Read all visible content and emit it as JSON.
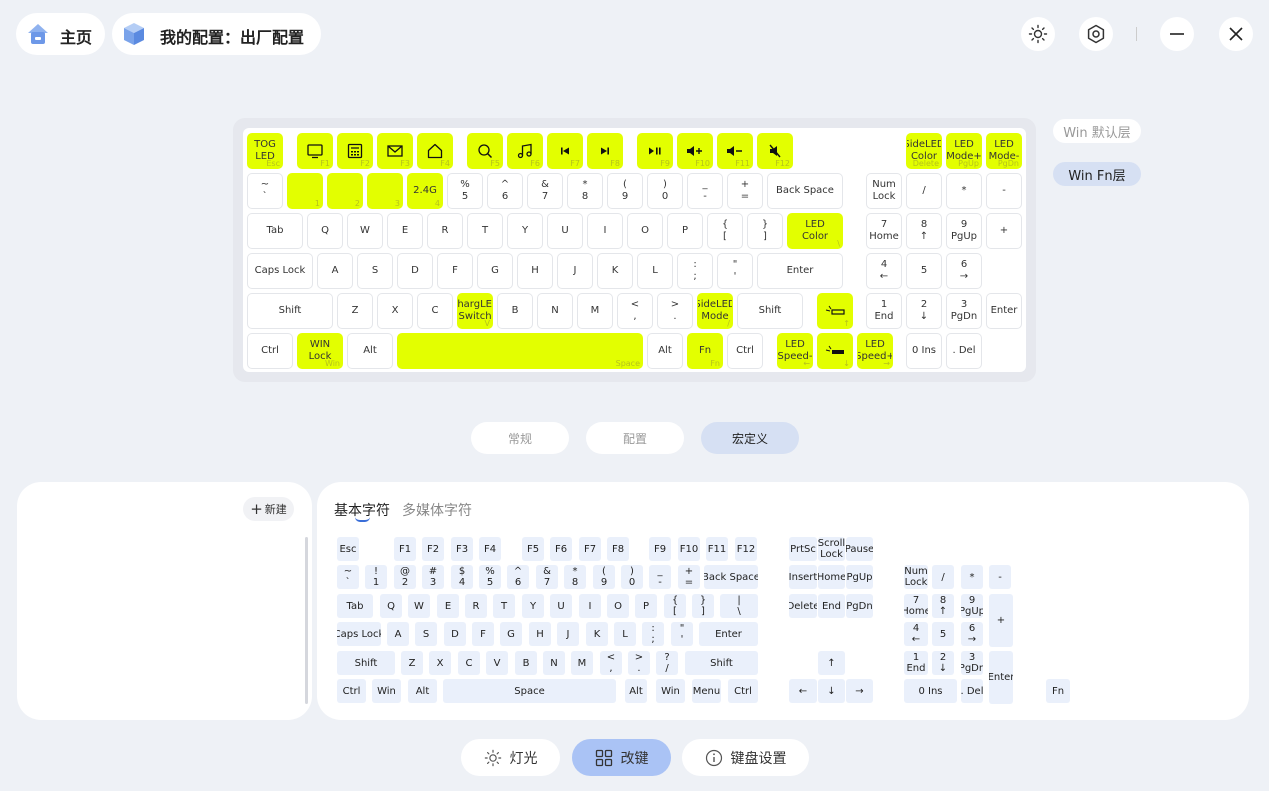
{
  "header": {
    "home_label": "主页",
    "config_label": "我的配置：出厂配置",
    "icons": [
      "house-icon",
      "cube-icon",
      "sun-icon",
      "settings-icon",
      "minimize-icon",
      "close-icon"
    ]
  },
  "keyboard": {
    "rows": [
      [
        {
          "l": [
            "TOG",
            "LED"
          ],
          "s": "Esc",
          "hl": true
        },
        {
          "i": "monitor-icon",
          "s": "F1",
          "hl": true
        },
        {
          "i": "calculator-icon",
          "s": "F2",
          "hl": true
        },
        {
          "i": "mail-icon",
          "s": "F3",
          "hl": true
        },
        {
          "i": "home-icon",
          "s": "F4",
          "hl": true
        },
        {
          "i": "search-icon",
          "s": "F5",
          "hl": true
        },
        {
          "i": "music-icon",
          "s": "F6",
          "hl": true
        },
        {
          "i": "prev-track-icon",
          "s": "F7",
          "hl": true
        },
        {
          "i": "next-track-icon",
          "s": "F8",
          "hl": true
        },
        {
          "i": "play-pause-icon",
          "s": "F9",
          "hl": true
        },
        {
          "i": "volume-up-icon",
          "s": "F10",
          "hl": true
        },
        {
          "i": "volume-down-icon",
          "s": "F11",
          "hl": true
        },
        {
          "i": "mute-icon",
          "s": "F12",
          "hl": true
        },
        {
          "l": [
            "SideLED",
            "Color"
          ],
          "s": "Delete",
          "hl": true
        },
        {
          "l": [
            "LED",
            "Mode+"
          ],
          "s": "PgUp",
          "hl": true
        },
        {
          "l": [
            "LED",
            "Mode-"
          ],
          "s": "PgDn",
          "hl": true
        }
      ],
      [
        {
          "l": [
            "~",
            "`"
          ]
        },
        {
          "l": [
            ""
          ],
          "s": "1",
          "hl": true
        },
        {
          "l": [
            ""
          ],
          "s": "2",
          "hl": true
        },
        {
          "l": [
            ""
          ],
          "s": "3",
          "hl": true
        },
        {
          "l": [
            "2.4G"
          ],
          "s": "4",
          "hl": true
        },
        {
          "l": [
            "%",
            "5"
          ]
        },
        {
          "l": [
            "^",
            "6"
          ]
        },
        {
          "l": [
            "&",
            "7"
          ]
        },
        {
          "l": [
            "*",
            "8"
          ]
        },
        {
          "l": [
            "(",
            "9"
          ]
        },
        {
          "l": [
            ")",
            "0"
          ]
        },
        {
          "l": [
            "_",
            "-"
          ]
        },
        {
          "l": [
            "+",
            "="
          ]
        },
        {
          "l": [
            "Back Space"
          ]
        },
        {
          "l": [
            "Num",
            "Lock"
          ]
        },
        {
          "l": [
            "/"
          ]
        },
        {
          "l": [
            "*"
          ]
        },
        {
          "l": [
            "-"
          ]
        }
      ],
      [
        {
          "l": [
            "Tab"
          ]
        },
        {
          "l": [
            "Q"
          ]
        },
        {
          "l": [
            "W"
          ]
        },
        {
          "l": [
            "E"
          ]
        },
        {
          "l": [
            "R"
          ]
        },
        {
          "l": [
            "T"
          ]
        },
        {
          "l": [
            "Y"
          ]
        },
        {
          "l": [
            "U"
          ]
        },
        {
          "l": [
            "I"
          ]
        },
        {
          "l": [
            "O"
          ]
        },
        {
          "l": [
            "P"
          ]
        },
        {
          "l": [
            "{",
            "["
          ]
        },
        {
          "l": [
            "}",
            "]"
          ]
        },
        {
          "l": [
            "LED",
            "Color"
          ],
          "s": "\\",
          "hl": true
        },
        {
          "l": [
            "7",
            "Home"
          ]
        },
        {
          "l": [
            "8",
            "↑"
          ]
        },
        {
          "l": [
            "9",
            "PgUp"
          ]
        },
        {
          "l": [
            "+"
          ]
        }
      ],
      [
        {
          "l": [
            "Caps Lock"
          ]
        },
        {
          "l": [
            "A"
          ]
        },
        {
          "l": [
            "S"
          ]
        },
        {
          "l": [
            "D"
          ]
        },
        {
          "l": [
            "F"
          ]
        },
        {
          "l": [
            "G"
          ]
        },
        {
          "l": [
            "H"
          ]
        },
        {
          "l": [
            "J"
          ]
        },
        {
          "l": [
            "K"
          ]
        },
        {
          "l": [
            "L"
          ]
        },
        {
          "l": [
            ":",
            ";"
          ]
        },
        {
          "l": [
            "\"",
            "'"
          ]
        },
        {
          "l": [
            "Enter"
          ]
        },
        {
          "l": [
            "4",
            "←"
          ]
        },
        {
          "l": [
            "5"
          ]
        },
        {
          "l": [
            "6",
            "→"
          ]
        }
      ],
      [
        {
          "l": [
            "Shift"
          ]
        },
        {
          "l": [
            "Z"
          ]
        },
        {
          "l": [
            "X"
          ]
        },
        {
          "l": [
            "C"
          ]
        },
        {
          "l": [
            "ChargLED",
            "Switch"
          ],
          "s": "V",
          "hl": true
        },
        {
          "l": [
            "B"
          ]
        },
        {
          "l": [
            "N"
          ]
        },
        {
          "l": [
            "M"
          ]
        },
        {
          "l": [
            "<",
            ","
          ]
        },
        {
          "l": [
            ">",
            "."
          ]
        },
        {
          "l": [
            "SideLED",
            "Mode"
          ],
          "s": "/",
          "hl": true
        },
        {
          "l": [
            "Shift"
          ]
        },
        {
          "i": "brightness-up-icon",
          "s": "↑",
          "hl": true
        },
        {
          "l": [
            "1",
            "End"
          ]
        },
        {
          "l": [
            "2",
            "↓"
          ]
        },
        {
          "l": [
            "3",
            "PgDn"
          ]
        },
        {
          "l": [
            "Enter"
          ]
        }
      ],
      [
        {
          "l": [
            "Ctrl"
          ]
        },
        {
          "l": [
            "WIN",
            "Lock"
          ],
          "s": "Win",
          "hl": true
        },
        {
          "l": [
            "Alt"
          ]
        },
        {
          "l": [
            ""
          ],
          "s": "Space",
          "hl": true
        },
        {
          "l": [
            "Alt"
          ]
        },
        {
          "l": [
            "Fn"
          ],
          "s": "Fn",
          "hl": true
        },
        {
          "l": [
            "Ctrl"
          ]
        },
        {
          "l": [
            "LED",
            "Speed-"
          ],
          "s": "←",
          "hl": true
        },
        {
          "i": "brightness-down-icon",
          "s": "↓",
          "hl": true
        },
        {
          "l": [
            "LED",
            "Speed+"
          ],
          "s": "→",
          "hl": true
        },
        {
          "l": [
            "0 Ins"
          ]
        },
        {
          "l": [
            ". Del"
          ]
        }
      ]
    ]
  },
  "layers": {
    "default": "Win 默认层",
    "fn": "Win Fn层"
  },
  "tabs": [
    "常规",
    "配置",
    "宏定义"
  ],
  "macro_panel": {
    "new_label": "新建"
  },
  "key_panel": {
    "tab_basic": "基本字符",
    "tab_media": "多媒体字符",
    "rows": [
      [
        [
          "Esc"
        ],
        [
          "F1"
        ],
        [
          "F2"
        ],
        [
          "F3"
        ],
        [
          "F4"
        ],
        [
          "F5"
        ],
        [
          "F6"
        ],
        [
          "F7"
        ],
        [
          "F8"
        ],
        [
          "F9"
        ],
        [
          "F10"
        ],
        [
          "F11"
        ],
        [
          "F12"
        ],
        [
          "PrtSc"
        ],
        [
          "Scroll",
          "Lock"
        ],
        [
          "Pause"
        ]
      ],
      [
        [
          "~",
          "`"
        ],
        [
          "!",
          "1"
        ],
        [
          "@",
          "2"
        ],
        [
          "#",
          "3"
        ],
        [
          "$",
          "4"
        ],
        [
          "%",
          "5"
        ],
        [
          "^",
          "6"
        ],
        [
          "&",
          "7"
        ],
        [
          "*",
          "8"
        ],
        [
          "(",
          "9"
        ],
        [
          ")",
          "0"
        ],
        [
          "_",
          "-"
        ],
        [
          "+",
          "="
        ],
        [
          "Back Space"
        ],
        [
          "Insert"
        ],
        [
          "Home"
        ],
        [
          "PgUp"
        ],
        [
          "Num",
          "Lock"
        ],
        [
          "/"
        ],
        [
          "*"
        ],
        [
          "-"
        ]
      ],
      [
        [
          "Tab"
        ],
        [
          "Q"
        ],
        [
          "W"
        ],
        [
          "E"
        ],
        [
          "R"
        ],
        [
          "T"
        ],
        [
          "Y"
        ],
        [
          "U"
        ],
        [
          "I"
        ],
        [
          "O"
        ],
        [
          "P"
        ],
        [
          "{",
          "["
        ],
        [
          "}",
          "]"
        ],
        [
          "|",
          "\\"
        ],
        [
          "Delete"
        ],
        [
          "End"
        ],
        [
          "PgDn"
        ],
        [
          "7",
          "Home"
        ],
        [
          "8",
          "↑"
        ],
        [
          "9",
          "PgUp"
        ],
        [
          "+"
        ]
      ],
      [
        [
          "Caps Lock"
        ],
        [
          "A"
        ],
        [
          "S"
        ],
        [
          "D"
        ],
        [
          "F"
        ],
        [
          "G"
        ],
        [
          "H"
        ],
        [
          "J"
        ],
        [
          "K"
        ],
        [
          "L"
        ],
        [
          ":",
          ";"
        ],
        [
          "\"",
          "'"
        ],
        [
          "Enter"
        ],
        [
          "4",
          "←"
        ],
        [
          "5"
        ],
        [
          "6",
          "→"
        ]
      ],
      [
        [
          "Shift"
        ],
        [
          "Z"
        ],
        [
          "X"
        ],
        [
          "C"
        ],
        [
          "V"
        ],
        [
          "B"
        ],
        [
          "N"
        ],
        [
          "M"
        ],
        [
          "<",
          ","
        ],
        [
          ">",
          "."
        ],
        [
          "?",
          "/"
        ],
        [
          "Shift"
        ],
        [
          "↑"
        ],
        [
          "1",
          "End"
        ],
        [
          "2",
          "↓"
        ],
        [
          "3",
          "PgDn"
        ],
        [
          "Enter"
        ]
      ],
      [
        [
          "Ctrl"
        ],
        [
          "Win"
        ],
        [
          "Alt"
        ],
        [
          "Space"
        ],
        [
          "Alt"
        ],
        [
          "Win"
        ],
        [
          "Menu"
        ],
        [
          "Ctrl"
        ],
        [
          "←"
        ],
        [
          "↓"
        ],
        [
          "→"
        ],
        [
          "0 Ins"
        ],
        [
          ". Del"
        ],
        [
          "Fn"
        ]
      ]
    ]
  },
  "bottom_nav": {
    "light": "灯光",
    "remap": "改键",
    "settings": "键盘设置"
  },
  "colors": {
    "highlight": "#e3ff00",
    "accent": "#aac3f5",
    "active_tab": "#d6e0f3",
    "key_bg": "#eaf0fb"
  }
}
